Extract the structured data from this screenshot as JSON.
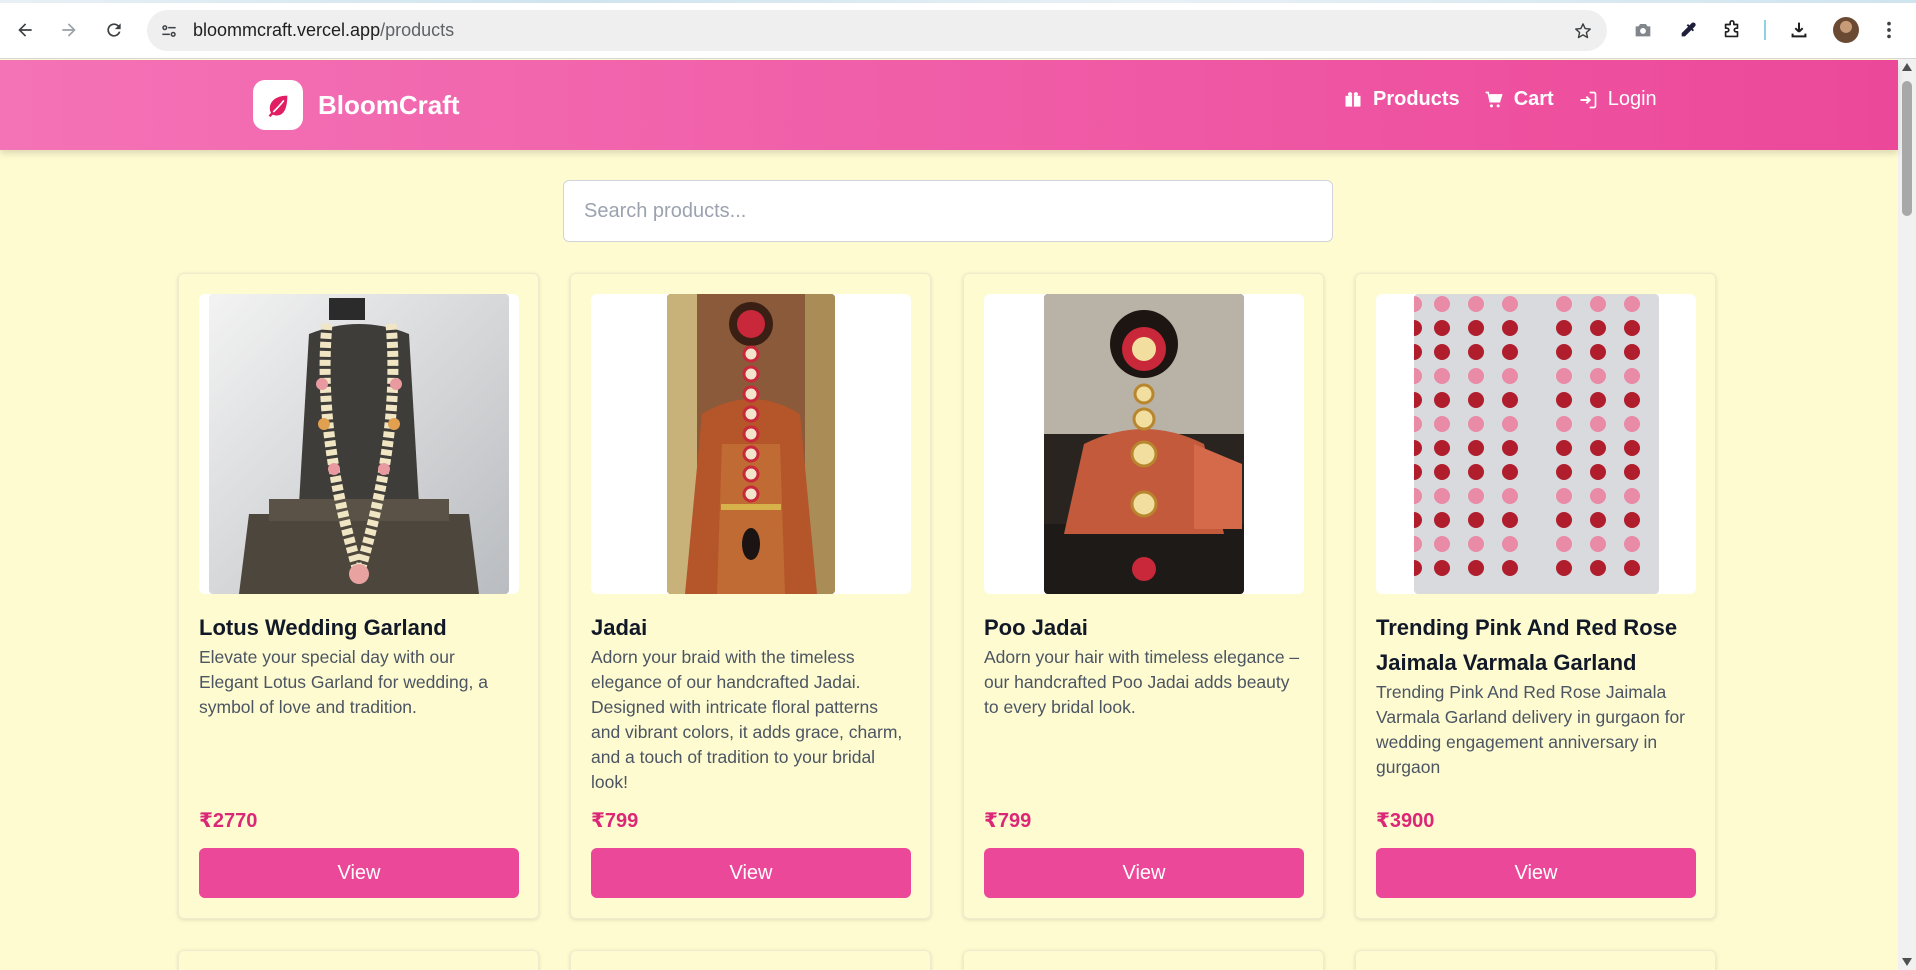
{
  "browser": {
    "url_domain": "bloommcraft.vercel.app",
    "url_path": "/products",
    "icons": [
      "back-icon",
      "forward-icon",
      "reload-icon",
      "site-info-icon",
      "bookmark-star-icon",
      "camera-icon",
      "eyedropper-icon",
      "extensions-icon",
      "download-icon",
      "profile-avatar",
      "kebab-menu-icon"
    ]
  },
  "header": {
    "brand_name": "BloomCraft",
    "nav": {
      "products": "Products",
      "cart": "Cart",
      "login": "Login"
    }
  },
  "search": {
    "placeholder": "Search products..."
  },
  "products": [
    {
      "title": "Lotus Wedding Garland",
      "description": "Elevate your special day with our Elegant Lotus Garland for wedding, a symbol of love and tradition.",
      "price": "₹2770",
      "button": "View"
    },
    {
      "title": "Jadai",
      "description": "Adorn your braid with the timeless elegance of our handcrafted Jadai. Designed with intricate floral patterns and vibrant colors, it adds grace, charm, and a touch of tradition to your bridal look!",
      "price": "₹799",
      "button": "View"
    },
    {
      "title": "Poo Jadai",
      "description": "Adorn your hair with timeless elegance – our handcrafted Poo Jadai adds beauty to every bridal look.",
      "price": "₹799",
      "button": "View"
    },
    {
      "title": "Trending Pink And Red Rose Jaimala Varmala Garland",
      "description": "Trending Pink And Red Rose Jaimala Varmala Garland delivery in gurgaon for wedding engagement anniversary in gurgaon",
      "price": "₹3900",
      "button": "View"
    }
  ],
  "colors": {
    "header_start": "#f472b6",
    "header_end": "#ec4899",
    "page_bg": "#fefbd0",
    "button": "#ec4899",
    "price": "#db2777"
  }
}
